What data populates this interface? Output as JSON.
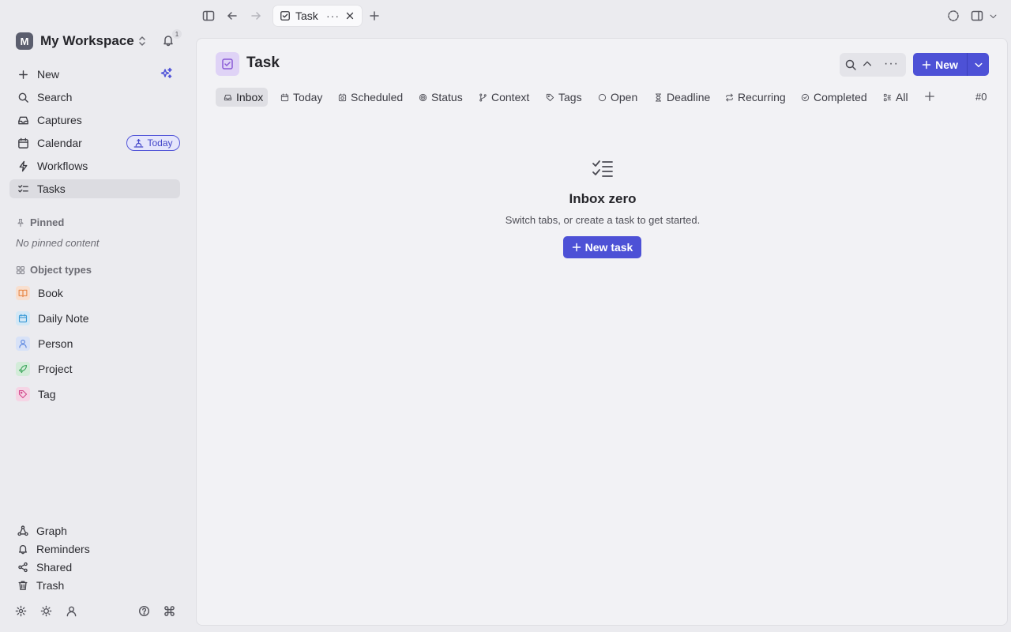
{
  "tab": {
    "label": "Task",
    "more": "···"
  },
  "workspace": {
    "avatar_letter": "M",
    "name": "My Workspace",
    "notification_count": "1"
  },
  "nav": {
    "items": [
      {
        "label": "New",
        "icon": "plus-icon"
      },
      {
        "label": "Search",
        "icon": "search-icon"
      },
      {
        "label": "Captures",
        "icon": "inbox-icon"
      },
      {
        "label": "Calendar",
        "icon": "calendar-icon"
      },
      {
        "label": "Workflows",
        "icon": "bolt-icon"
      },
      {
        "label": "Tasks",
        "icon": "checklist-icon"
      }
    ],
    "today_pill": "Today"
  },
  "pinned": {
    "heading": "Pinned",
    "empty": "No pinned content"
  },
  "object_types": {
    "heading": "Object types",
    "items": [
      {
        "label": "Book",
        "icon": "book-icon",
        "color": "#e8894a",
        "bg": "#f8dfcf"
      },
      {
        "label": "Daily Note",
        "icon": "calendar-icon",
        "color": "#3b9ad6",
        "bg": "#d3e8f6"
      },
      {
        "label": "Person",
        "icon": "person-icon",
        "color": "#5a86e0",
        "bg": "#d8e2f7"
      },
      {
        "label": "Project",
        "icon": "rocket-icon",
        "color": "#3aa65a",
        "bg": "#d3ecd9"
      },
      {
        "label": "Tag",
        "icon": "tag-icon",
        "color": "#d4488c",
        "bg": "#f5d5e5"
      }
    ]
  },
  "footer_nav": [
    {
      "label": "Graph",
      "icon": "graph-icon"
    },
    {
      "label": "Reminders",
      "icon": "bell-icon"
    },
    {
      "label": "Shared",
      "icon": "share-icon"
    },
    {
      "label": "Trash",
      "icon": "trash-icon"
    }
  ],
  "page": {
    "title": "Task",
    "new_button": "New",
    "accent": "#4d51d6",
    "count": "#0"
  },
  "view_tabs": [
    {
      "label": "Inbox",
      "icon": "inbox-icon"
    },
    {
      "label": "Today",
      "icon": "calendar-icon"
    },
    {
      "label": "Scheduled",
      "icon": "calendar-clock-icon"
    },
    {
      "label": "Status",
      "icon": "target-icon"
    },
    {
      "label": "Context",
      "icon": "branch-icon"
    },
    {
      "label": "Tags",
      "icon": "tag-icon"
    },
    {
      "label": "Open",
      "icon": "circle-icon"
    },
    {
      "label": "Deadline",
      "icon": "hourglass-icon"
    },
    {
      "label": "Recurring",
      "icon": "repeat-icon"
    },
    {
      "label": "Completed",
      "icon": "check-circle-icon"
    },
    {
      "label": "All",
      "icon": "grid-list-icon"
    }
  ],
  "empty_state": {
    "title": "Inbox zero",
    "subtitle": "Switch tabs, or create a task to get started.",
    "button": "New task"
  }
}
